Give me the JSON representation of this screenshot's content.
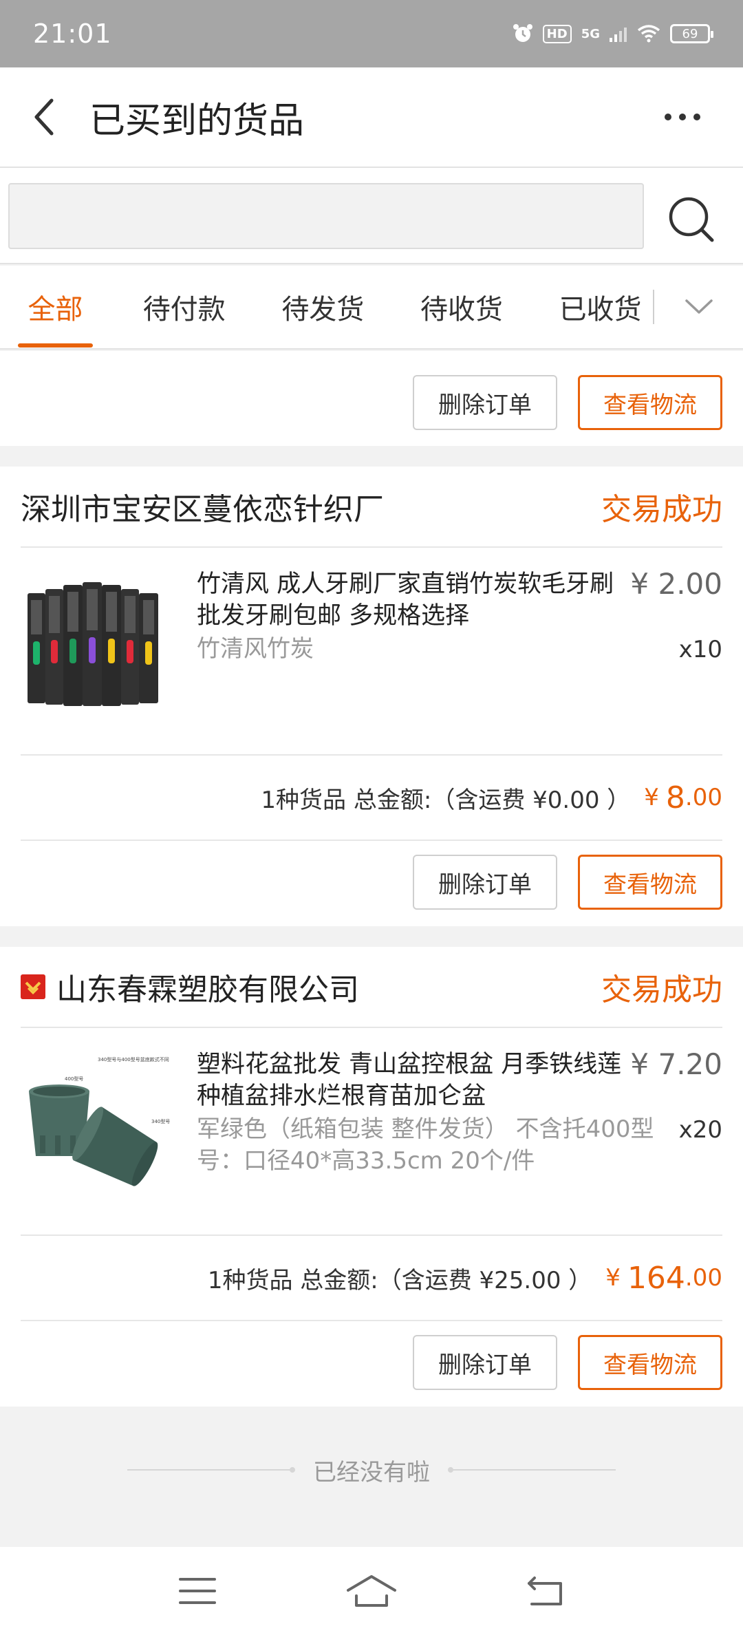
{
  "status_bar": {
    "time": "21:01",
    "hd": "HD",
    "signal": "5G",
    "battery": "69"
  },
  "header": {
    "title": "已买到的货品"
  },
  "search": {
    "value": "",
    "placeholder": ""
  },
  "tabs": [
    {
      "label": "全部",
      "active": true
    },
    {
      "label": "待付款",
      "active": false
    },
    {
      "label": "待发货",
      "active": false
    },
    {
      "label": "待收货",
      "active": false
    },
    {
      "label": "已收货",
      "active": false
    }
  ],
  "buttons": {
    "delete": "删除订单",
    "logistics": "查看物流"
  },
  "orders": [
    {
      "shop": "深圳市宝安区蔓依恋针织厂",
      "status": "交易成功",
      "item": {
        "title": "竹清风 成人牙刷厂家直销竹炭软毛牙刷批发牙刷包邮 多规格选择",
        "spec": "竹清风竹炭",
        "price": "¥ 2.00",
        "qty": "x10"
      },
      "total": {
        "text": "1种货品 总金额:（含运费 ¥0.00 ）",
        "symbol": "¥",
        "integer": "8",
        "decimal": ".00"
      }
    },
    {
      "shop": "山东春霖塑胶有限公司",
      "status": "交易成功",
      "item": {
        "title": "塑料花盆批发 青山盆控根盆 月季铁线莲种植盆排水烂根育苗加仑盆",
        "spec": "军绿色（纸箱包装 整件发货） 不含托400型号：口径40*高33.5cm 20个/件",
        "price": "¥ 7.20",
        "qty": "x20",
        "image_text_1": "340型号与400型号盆底款式不同",
        "image_text_2": "400型号",
        "image_text_3": "340型号"
      },
      "total": {
        "text": "1种货品 总金额:（含运费 ¥25.00 ）",
        "symbol": "¥",
        "integer": "164",
        "decimal": ".00"
      }
    }
  ],
  "end_message": "已经没有啦",
  "icons": {
    "back": "chevron-left-icon",
    "more": "more-dots-icon",
    "search": "search-icon",
    "tab_more": "chevron-down-icon",
    "nav_menu": "menu-icon",
    "nav_home": "home-icon",
    "nav_back": "back-return-icon"
  },
  "colors": {
    "accent": "#e8620a",
    "status_bar": "#a6a6a6",
    "shop_logo": "#d9251c"
  }
}
